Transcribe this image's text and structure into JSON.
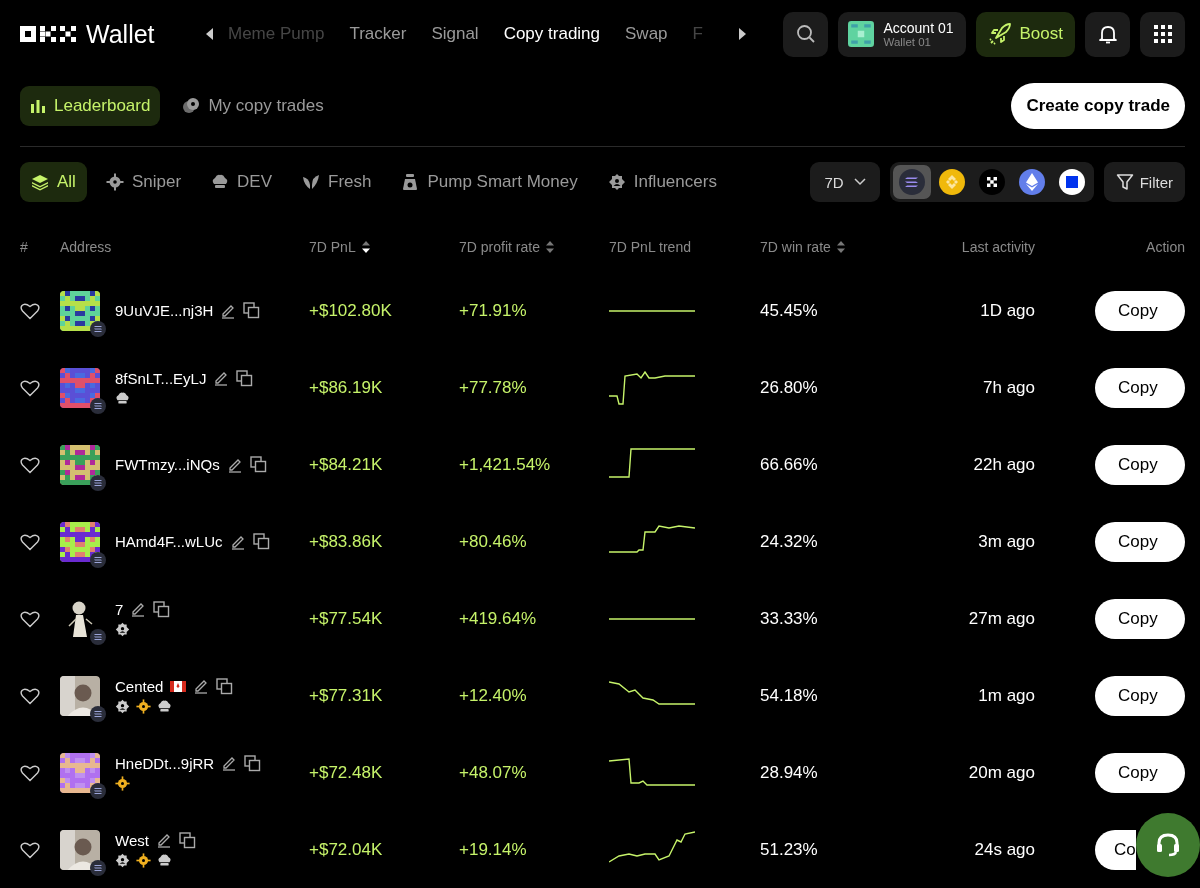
{
  "header": {
    "logo_text": "Wallet",
    "nav": [
      {
        "label": "Meme Pump",
        "selected": false,
        "faded": true
      },
      {
        "label": "Tracker",
        "selected": false,
        "faded": false
      },
      {
        "label": "Signal",
        "selected": false,
        "faded": false
      },
      {
        "label": "Copy trading",
        "selected": true,
        "faded": false
      },
      {
        "label": "Swap",
        "selected": false,
        "faded": false
      },
      {
        "label": "F",
        "selected": false,
        "faded": true
      }
    ],
    "account": {
      "name": "Account 01",
      "wallet": "Wallet 01"
    },
    "boost": "Boost"
  },
  "subnav": [
    {
      "label": "Leaderboard",
      "selected": true,
      "kind": "chart"
    },
    {
      "label": "My copy trades",
      "selected": false,
      "kind": "coins"
    }
  ],
  "create_button": "Create copy trade",
  "categories": [
    {
      "label": "All",
      "selected": true,
      "kind": "layers"
    },
    {
      "label": "Sniper",
      "selected": false,
      "kind": "target"
    },
    {
      "label": "DEV",
      "selected": false,
      "kind": "chef"
    },
    {
      "label": "Fresh",
      "selected": false,
      "kind": "leaf"
    },
    {
      "label": "Pump Smart Money",
      "selected": false,
      "kind": "moneybag"
    },
    {
      "label": "Influencers",
      "selected": false,
      "kind": "badge"
    }
  ],
  "period": "7D",
  "chains": [
    {
      "kind": "solana",
      "selected": true
    },
    {
      "kind": "bnb",
      "selected": false
    },
    {
      "kind": "okx",
      "selected": false
    },
    {
      "kind": "ethereum",
      "selected": false
    },
    {
      "kind": "base",
      "selected": false
    }
  ],
  "filter": "Filter",
  "table": {
    "columns": [
      {
        "label": "#"
      },
      {
        "label": "Address"
      },
      {
        "label": "7D PnL",
        "sortable": true,
        "sorted": true
      },
      {
        "label": "7D profit rate",
        "sortable": true,
        "sorted": false
      },
      {
        "label": "7D PnL trend"
      },
      {
        "label": "7D win rate",
        "sortable": true,
        "sorted": false
      },
      {
        "label": "Last activity"
      },
      {
        "label": "Action"
      }
    ],
    "rows": [
      {
        "favorited": false,
        "avatar": {
          "kind": "pixel"
        },
        "name": "9UuVJE...nj3H",
        "tags": [],
        "pnl": "+$102.80K",
        "profit_rate": "+71.91%",
        "win_rate": "45.45%",
        "last_activity": "1D ago",
        "action": "Copy"
      },
      {
        "favorited": false,
        "avatar": {
          "kind": "pixel"
        },
        "name": "8fSnLT...EyLJ",
        "tags": [
          {
            "kind": "dev"
          }
        ],
        "pnl": "+$86.19K",
        "profit_rate": "+77.78%",
        "win_rate": "26.80%",
        "last_activity": "7h ago",
        "action": "Copy"
      },
      {
        "favorited": false,
        "avatar": {
          "kind": "pixel"
        },
        "name": "FWTmzy...iNQs",
        "tags": [],
        "pnl": "+$84.21K",
        "profit_rate": "+1,421.54%",
        "win_rate": "66.66%",
        "last_activity": "22h ago",
        "action": "Copy"
      },
      {
        "favorited": false,
        "avatar": {
          "kind": "pixel"
        },
        "name": "HAmd4F...wLUc",
        "tags": [],
        "pnl": "+$83.86K",
        "profit_rate": "+80.46%",
        "win_rate": "24.32%",
        "last_activity": "3m ago",
        "action": "Copy"
      },
      {
        "favorited": false,
        "avatar": {
          "kind": "figure"
        },
        "name": "7",
        "tags": [
          {
            "kind": "influencer"
          }
        ],
        "pnl": "+$77.54K",
        "profit_rate": "+419.64%",
        "win_rate": "33.33%",
        "last_activity": "27m ago",
        "action": "Copy"
      },
      {
        "favorited": false,
        "avatar": {
          "kind": "photo"
        },
        "name": "Cented",
        "flag": {
          "kind": "canada"
        },
        "tags": [
          {
            "kind": "influencer"
          },
          {
            "kind": "sniper"
          },
          {
            "kind": "dev"
          }
        ],
        "pnl": "+$77.31K",
        "profit_rate": "+12.40%",
        "win_rate": "54.18%",
        "last_activity": "1m ago",
        "action": "Copy"
      },
      {
        "favorited": false,
        "avatar": {
          "kind": "pixel"
        },
        "name": "HneDDt...9jRR",
        "tags": [
          {
            "kind": "sniper"
          }
        ],
        "pnl": "+$72.48K",
        "profit_rate": "+48.07%",
        "win_rate": "28.94%",
        "last_activity": "20m ago",
        "action": "Copy"
      },
      {
        "favorited": false,
        "avatar": {
          "kind": "photo"
        },
        "name": "West",
        "tags": [
          {
            "kind": "influencer"
          },
          {
            "kind": "sniper"
          },
          {
            "kind": "dev"
          }
        ],
        "pnl": "+$72.04K",
        "profit_rate": "+19.14%",
        "win_rate": "51.23%",
        "last_activity": "24s ago",
        "action": "Co"
      }
    ]
  }
}
